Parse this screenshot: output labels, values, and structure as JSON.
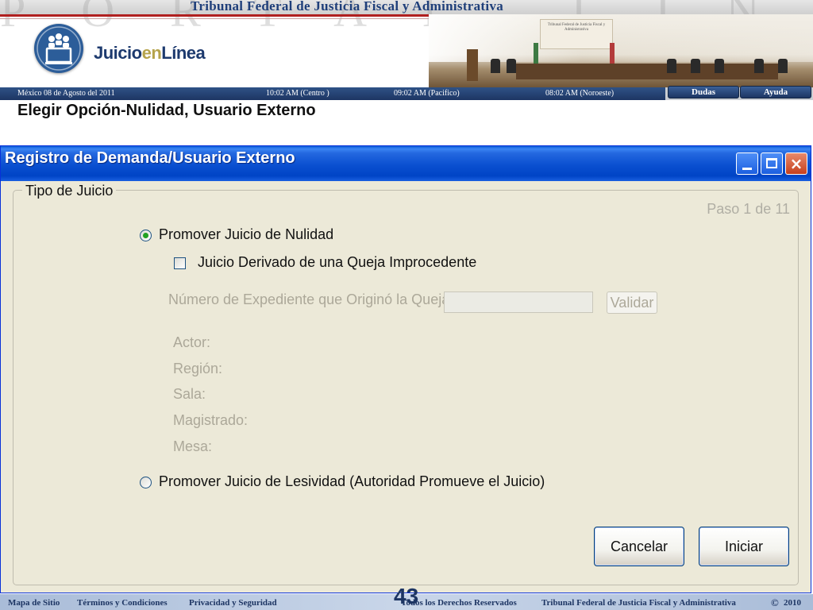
{
  "banner": {
    "watermark": "PORTAL LINEA",
    "title": "Tribunal Federal de Justicia Fiscal y Administrativa",
    "logo": {
      "part1": "Juicio",
      "part2": "en",
      "part3": "Línea",
      "icon": "people-monitor-icon"
    },
    "court_plaque": "Tribunal Federal de Justicia Fiscal y Administrativa"
  },
  "info_bar": {
    "date": "México 08 de Agosto del 2011",
    "time_centro": "10:02  AM (Centro )",
    "time_pacifico": "09:02 AM  (Pacifico)",
    "time_noroeste": "08:02 AM (Noroeste)"
  },
  "top_buttons": {
    "dudas": "Dudas",
    "ayuda": "Ayuda"
  },
  "page_heading": "Elegir Opción-Nulidad, Usuario Externo",
  "window": {
    "title": "Registro de Demanda/Usuario Externo",
    "controls": {
      "minimize": "minimize-icon",
      "maximize": "maximize-icon",
      "close": "×"
    },
    "group_label": "Tipo de Juicio",
    "step": "Paso 1 de 11",
    "options": {
      "nulidad": {
        "label": "Promover Juicio de Nulidad",
        "selected": true
      },
      "derivado": {
        "label": "Juicio Derivado de una Queja Improcedente",
        "checked": false
      },
      "lesividad": {
        "label": "Promover Juicio de Lesividad (Autoridad Promueve el Juicio)",
        "selected": false
      }
    },
    "expediente_label": "Número de Expediente que Originó la Queja",
    "expediente_value": "",
    "validar_button": "Validar",
    "fields": [
      "Actor:",
      "Región:",
      "Sala:",
      "Magistrado:",
      "Mesa:"
    ],
    "cancel_button": "Cancelar",
    "start_button": "Iniciar"
  },
  "footer": {
    "mapa": "Mapa de Sitio",
    "terminos": "Términos y Condiciones",
    "privacidad": "Privacidad y Seguridad",
    "derechos": "Todos los Derechos Reservados",
    "copyright": "Tribunal Federal de Justicia Fiscal y Administrativa",
    "copyright_symbol": "©",
    "year": "2010"
  },
  "slide_number": "43",
  "colors": {
    "xp_blue": "#0054e3",
    "window_bg": "#ece9d8",
    "navy": "#1d3563",
    "radio_green": "#21a121"
  }
}
